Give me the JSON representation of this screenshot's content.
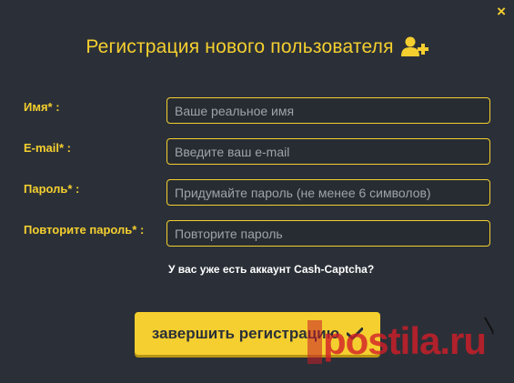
{
  "modal": {
    "close_label": "×",
    "title": "Регистрация нового пользователя",
    "title_icon": "user-add-icon"
  },
  "form": {
    "fields": [
      {
        "label": "Имя* :",
        "placeholder": "Ваше реальное имя",
        "value": ""
      },
      {
        "label": "E-mail* :",
        "placeholder": "Введите ваш e-mail",
        "value": ""
      },
      {
        "label": "Пароль* :",
        "placeholder": "Придумайте пароль (не менее 6 символов)",
        "value": ""
      },
      {
        "label": "Повторите пароль* :",
        "placeholder": "Повторите пароль",
        "value": ""
      }
    ],
    "account_link": "У вас уже есть аккаунт Cash-Captcha?",
    "submit_label": "завершить регистрацию",
    "submit_icon": "check-icon"
  },
  "watermark": {
    "text": "postila.ru"
  },
  "colors": {
    "background": "#2b3038",
    "accent": "#f5cf2f",
    "link": "#ffffff",
    "input_bg": "#272c33",
    "placeholder": "#9ea3ab",
    "watermark": "#d21e28"
  }
}
